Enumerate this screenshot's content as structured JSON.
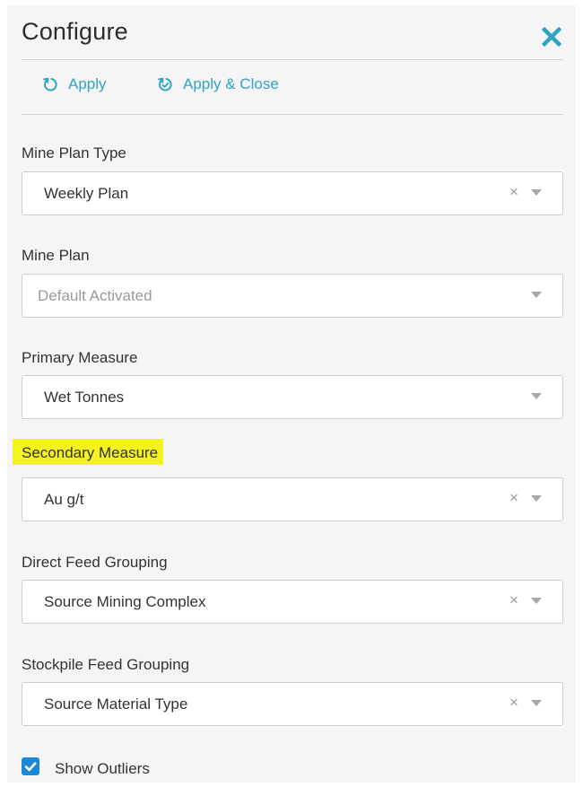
{
  "header": {
    "title": "Configure",
    "close_icon": "close-x-icon",
    "accent_color": "#2fa4c5"
  },
  "actions": {
    "apply_label": "Apply",
    "apply_close_label": "Apply & Close"
  },
  "fields": {
    "mine_plan_type": {
      "label": "Mine Plan Type",
      "value": "Weekly Plan",
      "clear": "×"
    },
    "mine_plan": {
      "label": "Mine Plan",
      "placeholder": "Default Activated"
    },
    "primary_measure": {
      "label": "Primary Measure",
      "value": "Wet Tonnes"
    },
    "secondary_measure": {
      "label": "Secondary Measure",
      "value": "Au g/t",
      "clear": "×",
      "highlight_color": "#f4f21f"
    },
    "direct_feed_grouping": {
      "label": "Direct Feed Grouping",
      "value": "Source Mining Complex",
      "clear": "×"
    },
    "stockpile_feed_grouping": {
      "label": "Stockpile Feed Grouping",
      "value": "Source Material Type",
      "clear": "×"
    }
  },
  "options": {
    "show_outliers": {
      "label": "Show Outliers",
      "checked": true,
      "check_color": "#1e88d8"
    }
  }
}
